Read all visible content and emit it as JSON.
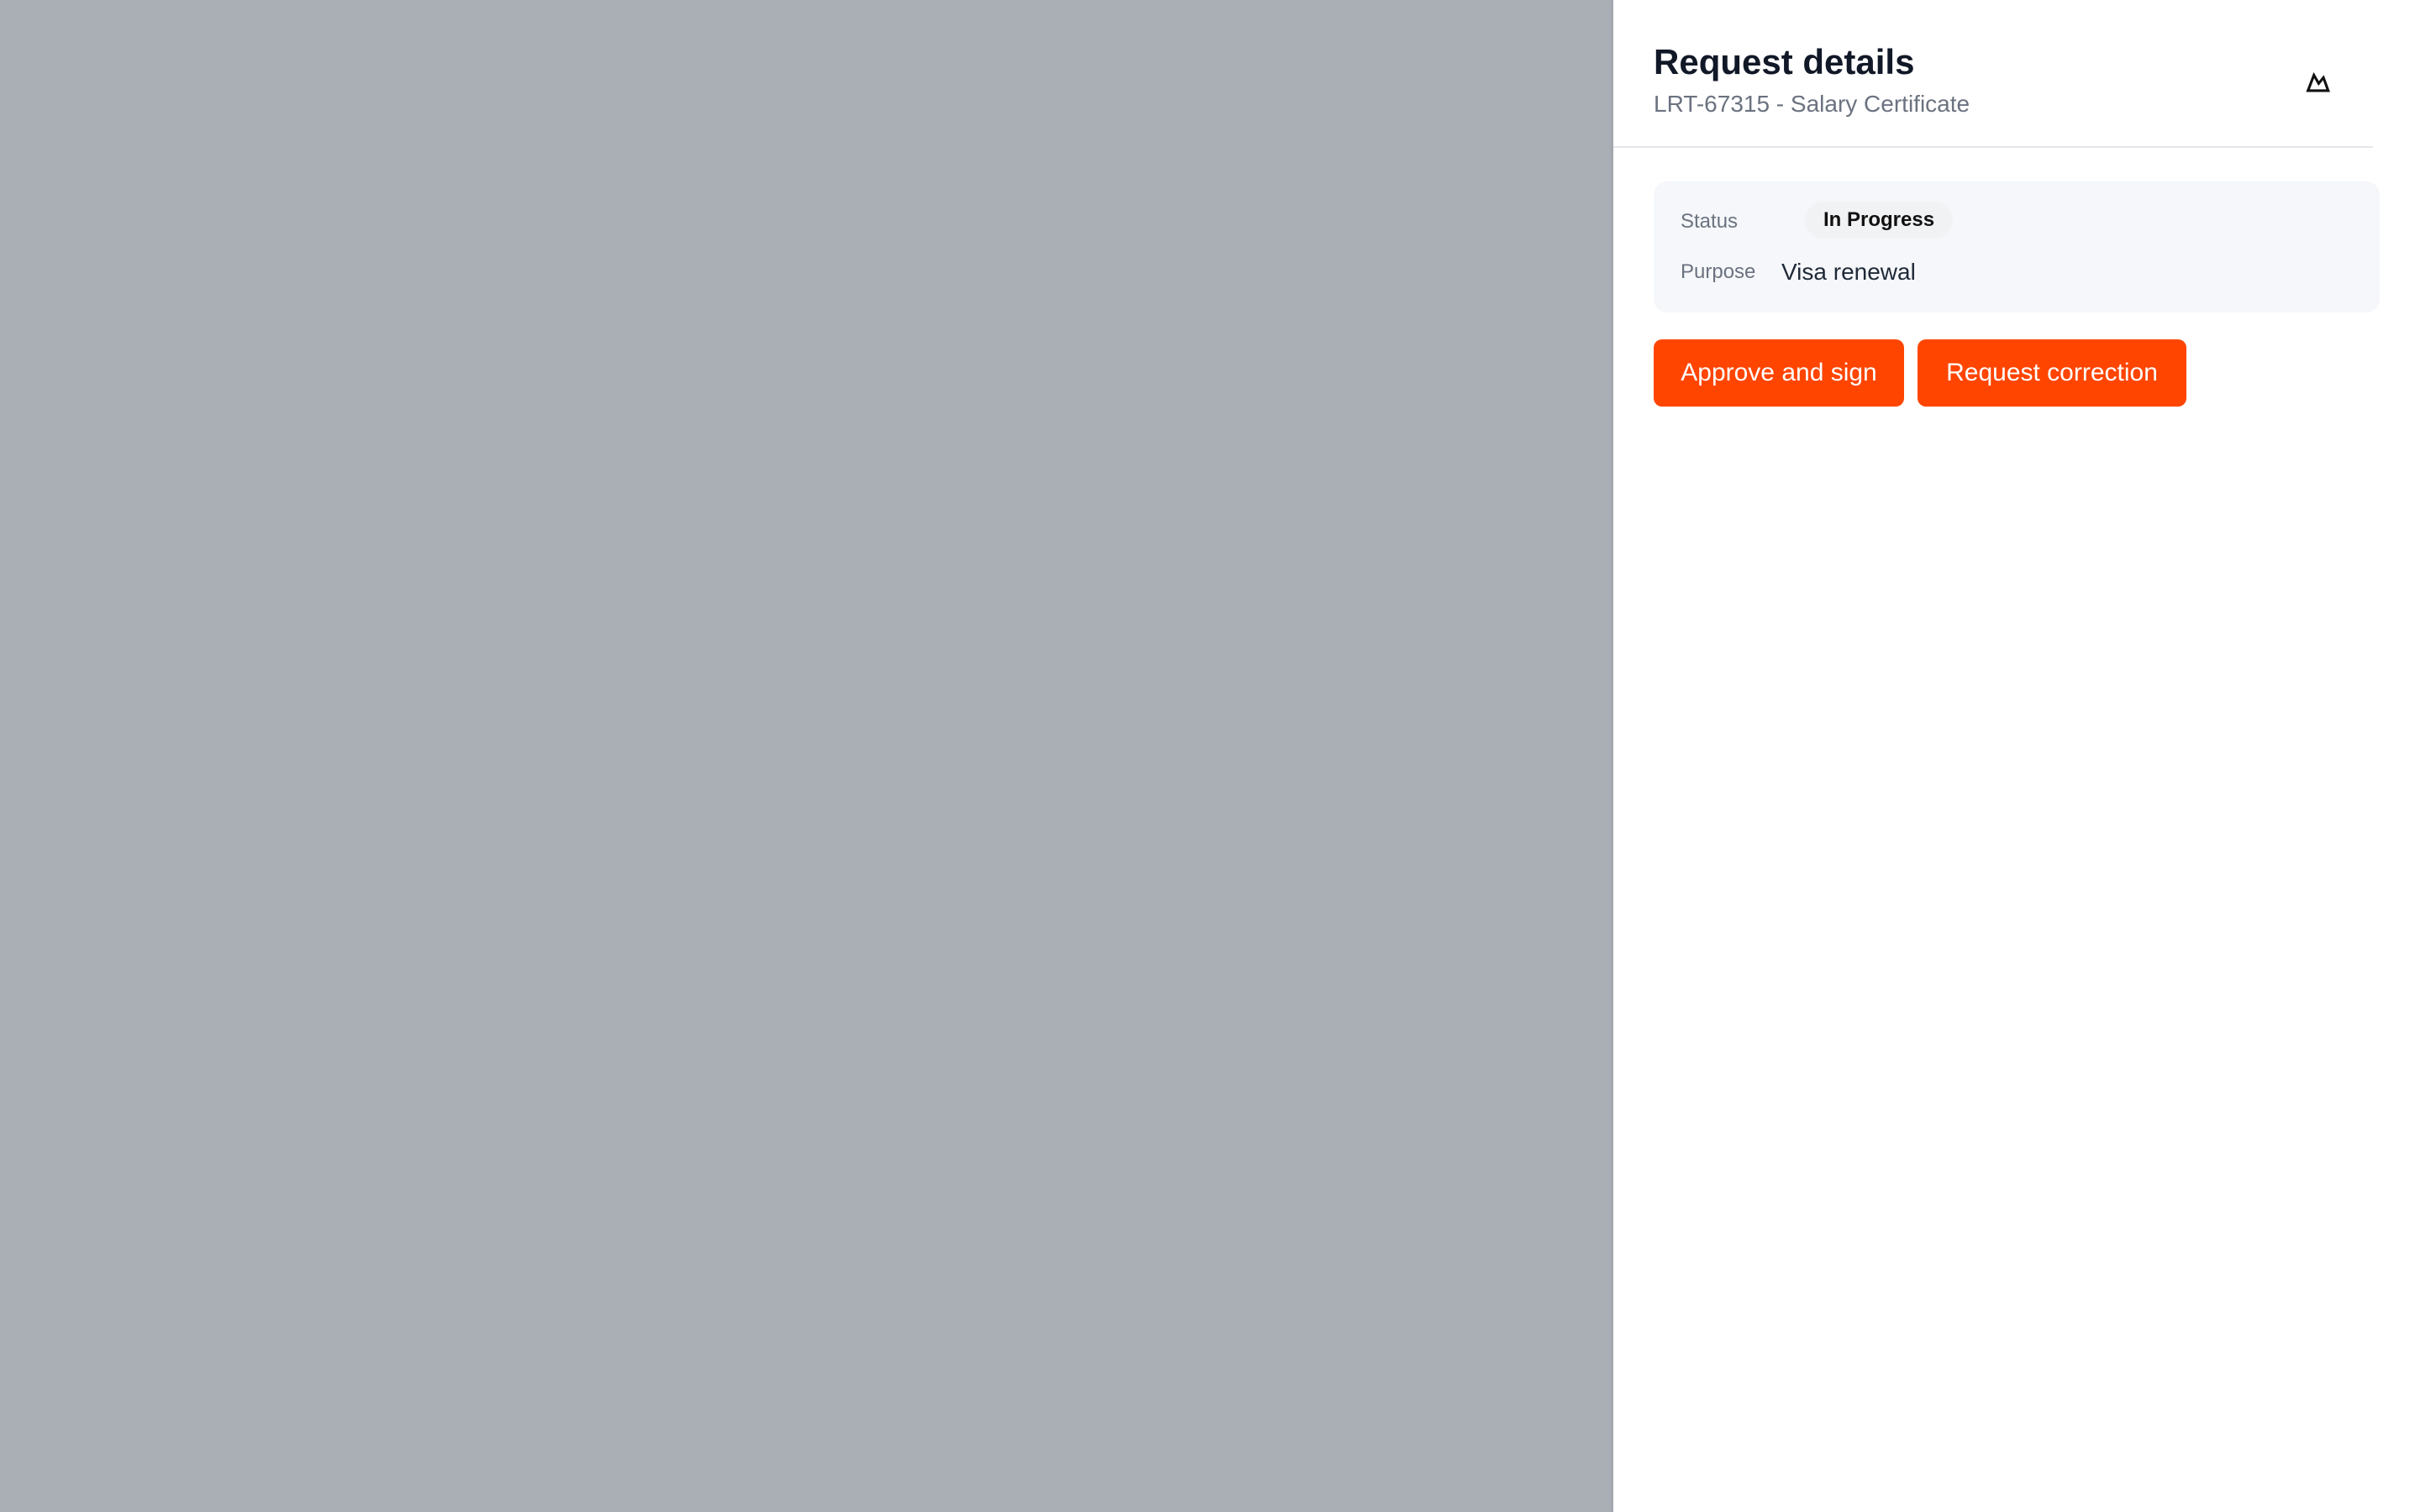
{
  "drawer": {
    "title": "Request details",
    "subtitle": "LRT-67315 - Salary Certificate",
    "close_icon": "mountain-icon"
  },
  "details": {
    "status_label": "Status",
    "status_value": "In Progress",
    "purpose_label": "Purpose",
    "purpose_value": "Visa renewal"
  },
  "actions": {
    "approve_label": "Approve and sign",
    "correction_label": "Request correction"
  },
  "colors": {
    "backdrop": "#aaaeb5",
    "accent": "#ff4500",
    "card": "#f5f7fa"
  }
}
